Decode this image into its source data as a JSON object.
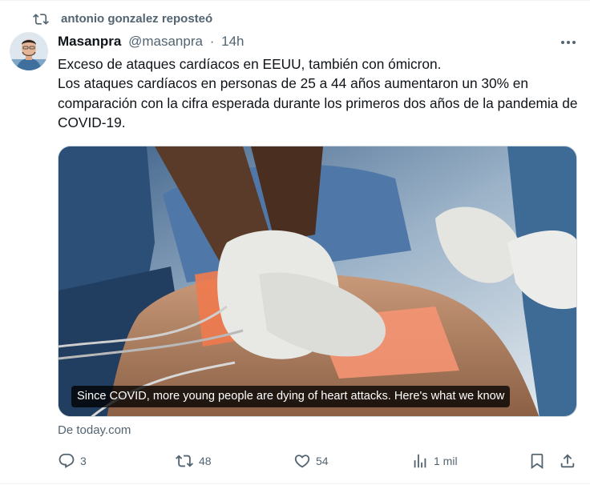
{
  "repost": {
    "label": "antonio gonzalez reposteó",
    "icon": "repost-icon"
  },
  "tweet": {
    "author_name": "Masanpra",
    "handle": "@masanpra",
    "time": "14h",
    "separator": "·",
    "text": "Exceso de ataques cardíacos en EEUU, también con ómicron.\nLos ataques cardíacos en personas de 25 a 44 años aumentaron un 30% en comparación con la cifra esperada durante los primeros dos años de la pandemia de COVID-19.",
    "media_caption": "Since COVID, more young people are dying of heart attacks. Here's what we know",
    "source": "De today.com"
  },
  "actions": {
    "replies": "3",
    "reposts": "48",
    "likes": "54",
    "views": "1 mil"
  },
  "icons": [
    "more-icon",
    "repost-icon",
    "reply-icon",
    "like-icon",
    "views-icon",
    "bookmark-icon",
    "share-icon"
  ],
  "colors": {
    "text_primary": "#0f1419",
    "text_secondary": "#536471",
    "border": "#cfd9de"
  }
}
